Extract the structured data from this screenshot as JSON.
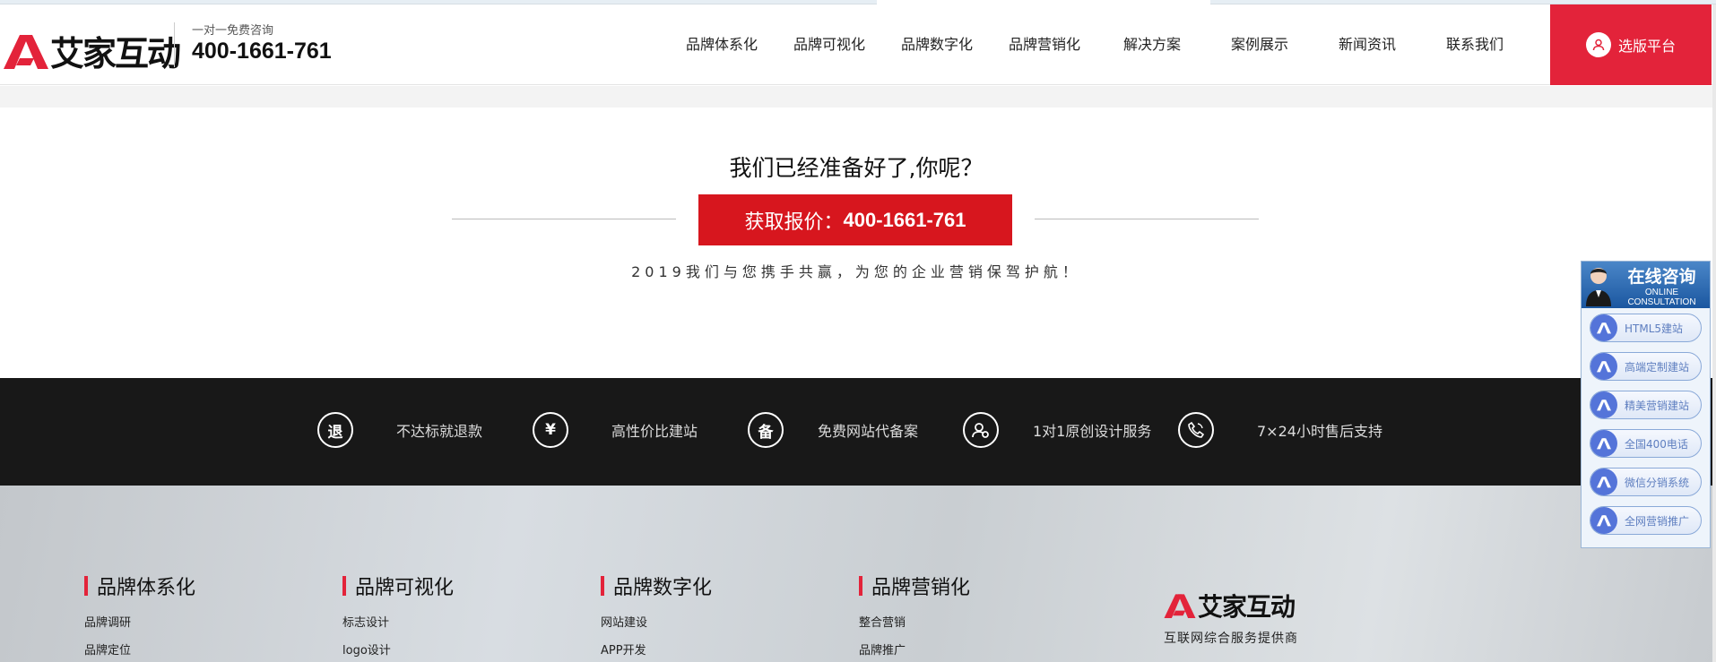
{
  "header": {
    "brand": "艾家互动",
    "hotline_caption": "一对一免费咨询",
    "hotline_number": "400-1661-761",
    "nav": [
      "品牌体系化",
      "品牌可视化",
      "品牌数字化",
      "品牌营销化",
      "解决方案",
      "案例展示",
      "新闻资讯",
      "联系我们"
    ],
    "platform_button": "选版平台"
  },
  "cta": {
    "title": "我们已经准备好了,你呢？",
    "button_prefix": "获取报价：",
    "button_number": "400-1661-761",
    "subtitle": "2019我们与您携手共赢，为您的企业营销保驾护航！"
  },
  "features": [
    {
      "glyph": "退",
      "label": "不达标就退款",
      "icon": "refund-icon"
    },
    {
      "glyph": "¥",
      "label": "高性价比建站",
      "icon": "yuan-icon"
    },
    {
      "glyph": "备",
      "label": "免费网站代备案",
      "icon": "record-icon"
    },
    {
      "glyph": "",
      "label": "1对1原创设计服务",
      "icon": "designer-icon"
    },
    {
      "glyph": "",
      "label": "7×24小时售后支持",
      "icon": "phone-icon"
    }
  ],
  "footer": {
    "columns": [
      {
        "title": "品牌体系化",
        "links": [
          "品牌调研",
          "品牌定位"
        ]
      },
      {
        "title": "品牌可视化",
        "links": [
          "标志设计",
          "logo设计"
        ]
      },
      {
        "title": "品牌数字化",
        "links": [
          "网站建设",
          "APP开发"
        ]
      },
      {
        "title": "品牌营销化",
        "links": [
          "整合营销",
          "品牌推广"
        ]
      }
    ],
    "brand": "艾家互动",
    "tagline": "互联网综合服务提供商"
  },
  "widget": {
    "title": "在线咨询",
    "subtitle": "ONLINE CONSULTATION",
    "items": [
      "HTML5建站",
      "高端定制建站",
      "精美营销建站",
      "全国400电话",
      "微信分销系统",
      "全网营销推广"
    ]
  },
  "colors": {
    "accent": "#e3233a",
    "cta_red": "#d7161e",
    "dark_band": "#181818",
    "widget_blue": "#5474d9"
  }
}
